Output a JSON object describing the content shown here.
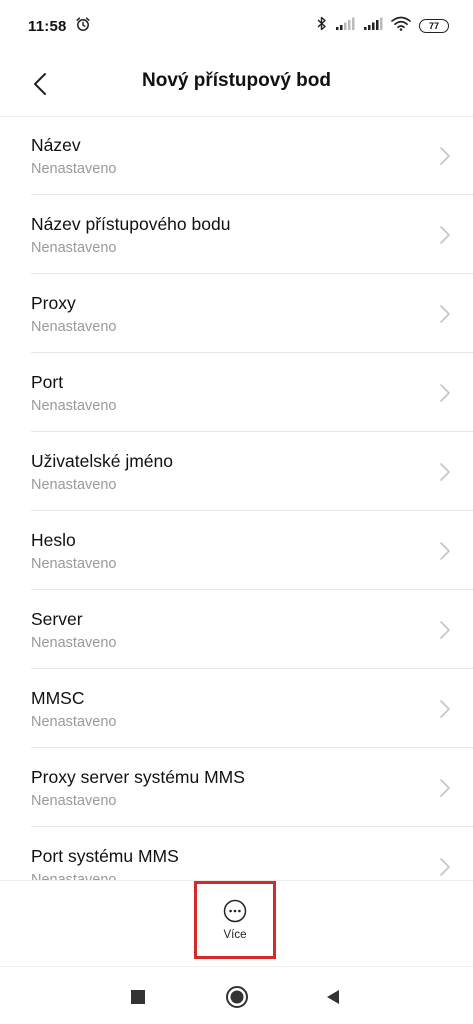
{
  "status_bar": {
    "time": "11:58",
    "battery": "77"
  },
  "header": {
    "title": "Nový přístupový bod"
  },
  "items": [
    {
      "title": "Název",
      "value": "Nenastaveno"
    },
    {
      "title": "Název přístupového bodu",
      "value": "Nenastaveno"
    },
    {
      "title": "Proxy",
      "value": "Nenastaveno"
    },
    {
      "title": "Port",
      "value": "Nenastaveno"
    },
    {
      "title": "Uživatelské jméno",
      "value": "Nenastaveno"
    },
    {
      "title": "Heslo",
      "value": "Nenastaveno"
    },
    {
      "title": "Server",
      "value": "Nenastaveno"
    },
    {
      "title": "MMSC",
      "value": "Nenastaveno"
    },
    {
      "title": "Proxy server systému MMS",
      "value": "Nenastaveno"
    },
    {
      "title": "Port systému MMS",
      "value": "Nenastaveno"
    }
  ],
  "bottom": {
    "more_label": "Více",
    "more_icon": "more-horizontal-icon",
    "highlight_color": "#d42a2a"
  },
  "navigation": {
    "recents_icon": "square-icon",
    "home_icon": "circle-icon",
    "back_icon": "triangle-back-icon"
  }
}
